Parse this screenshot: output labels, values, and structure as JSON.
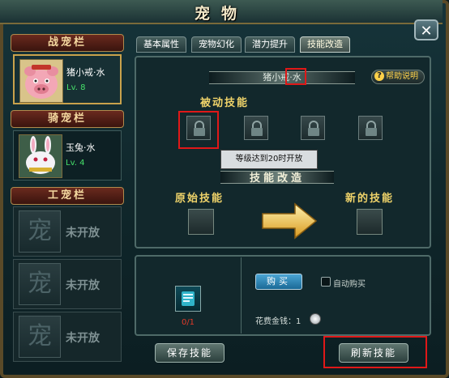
{
  "window": {
    "title": "宠物",
    "close_label": "✕"
  },
  "sidebar": {
    "battle_header": "战宠栏",
    "battle_pet": {
      "name": "猪小戒·水",
      "level": "Lv. 8"
    },
    "mount_header": "骑宠栏",
    "mount_pet": {
      "name": "玉兔·水",
      "level": "Lv. 4"
    },
    "work_header": "工宠栏",
    "work_slots": [
      {
        "icon": "宠",
        "label": "未开放"
      },
      {
        "icon": "宠",
        "label": "未开放"
      },
      {
        "icon": "宠",
        "label": "未开放"
      }
    ]
  },
  "tabs": [
    "基本属性",
    "宠物幻化",
    "潜力提升",
    "技能改造"
  ],
  "active_tab": "技能改造",
  "skill": {
    "pet_name": "猪小戒·",
    "pet_attr": "水",
    "help_label": "帮助说明",
    "passive_title": "被动技能",
    "tooltip": "等级达到20时开放",
    "rebuild_title": "技能改造",
    "original_label": "原始技能",
    "new_label": "新的技能"
  },
  "purchase": {
    "item_count": "0/1",
    "buy_label": "购买",
    "auto_buy_label": "自动购买",
    "cost_label": "花费金钱：1"
  },
  "buttons": {
    "save": "保存技能",
    "refresh": "刷新技能"
  },
  "colors": {
    "highlight": "#e01818",
    "accent_gold": "#f0d46a",
    "level_green": "#46e06a"
  }
}
